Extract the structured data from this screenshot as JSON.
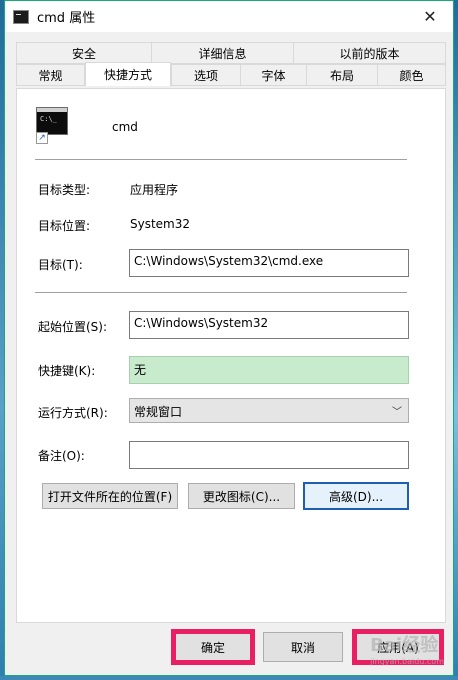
{
  "window": {
    "title": "cmd 属性",
    "close_icon": "close-icon"
  },
  "tabs": {
    "row_back": [
      "安全",
      "详细信息",
      "以前的版本"
    ],
    "row_front": [
      "常规",
      "快捷方式",
      "选项",
      "字体",
      "布局",
      "颜色"
    ],
    "active": "快捷方式"
  },
  "shortcut": {
    "app_name": "cmd",
    "app_icon_prompt": "C:\\_",
    "target_type_label": "目标类型:",
    "target_type_value": "应用程序",
    "target_location_label": "目标位置:",
    "target_location_value": "System32",
    "target_label": "目标(T):",
    "target_value": "C:\\Windows\\System32\\cmd.exe",
    "start_in_label": "起始位置(S):",
    "start_in_value": "C:\\Windows\\System32",
    "hotkey_label": "快捷键(K):",
    "hotkey_value": "无",
    "run_label": "运行方式(R):",
    "run_value": "常规窗口",
    "comment_label": "备注(O):",
    "comment_value": "",
    "open_location_btn": "打开文件所在的位置(F)",
    "change_icon_btn": "更改图标(C)...",
    "advanced_btn": "高级(D)..."
  },
  "footer": {
    "ok": "确定",
    "cancel": "取消",
    "apply": "应用(A)"
  },
  "watermark": {
    "main": "Bai经验",
    "sub": "jingyan.baidu.com"
  },
  "colors": {
    "highlight": "#ea1e63",
    "hotkey_bg": "#c7ebcc",
    "focus_border": "#1e5fb4"
  }
}
